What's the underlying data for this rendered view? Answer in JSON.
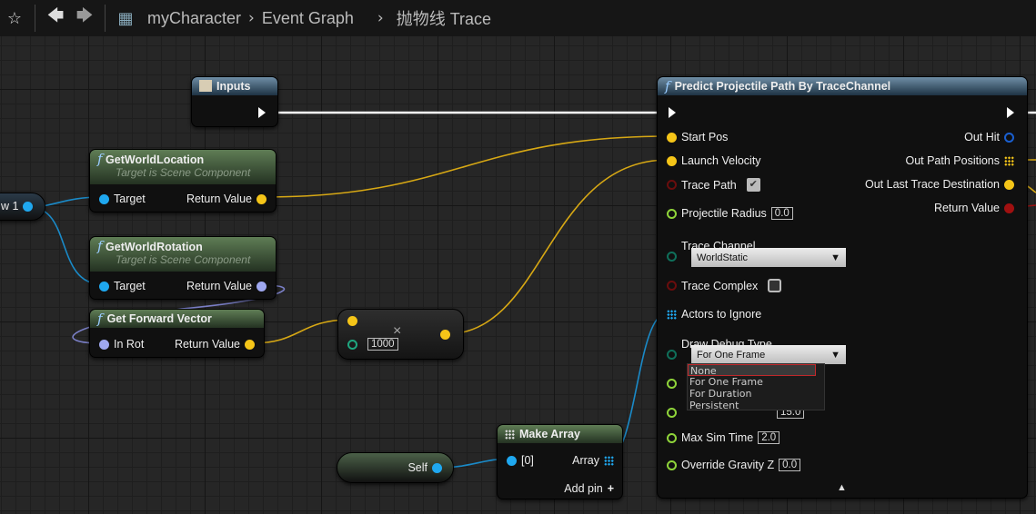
{
  "toolbar": {
    "breadcrumbs": [
      "myCharacter",
      "Event Graph",
      "抛物线 Trace"
    ],
    "icons": [
      "star-icon",
      "back-arrow-icon",
      "forward-arrow-icon",
      "blueprint-icon"
    ]
  },
  "nodes": {
    "var_node": {
      "label": "w 1"
    },
    "inputs": {
      "title": "Inputs"
    },
    "get_world_location": {
      "title": "GetWorldLocation",
      "subtitle": "Target is Scene Component",
      "in": "Target",
      "out": "Return Value"
    },
    "get_world_rotation": {
      "title": "GetWorldRotation",
      "subtitle": "Target is Scene Component",
      "in": "Target",
      "out": "Return Value"
    },
    "get_forward_vector": {
      "title": "Get Forward Vector",
      "in": "In Rot",
      "out": "Return Value"
    },
    "multiply": {
      "symbol": "×",
      "value": "1000"
    },
    "self": {
      "label": "Self"
    },
    "make_array": {
      "title": "Make Array",
      "in": "[0]",
      "out": "Array",
      "add_pin": "Add pin"
    },
    "predict": {
      "title": "Predict Projectile Path By TraceChannel",
      "inputs": {
        "start_pos": "Start Pos",
        "launch_velocity": "Launch Velocity",
        "trace_path": "Trace Path",
        "trace_path_checked": true,
        "projectile_radius": "Projectile Radius",
        "projectile_radius_value": "0.0",
        "trace_channel": "Trace Channel",
        "trace_channel_value": "WorldStatic",
        "trace_complex": "Trace Complex",
        "trace_complex_checked": false,
        "actors_to_ignore": "Actors to Ignore",
        "draw_debug_type": "Draw Debug Type",
        "draw_debug_type_value": "For One Frame",
        "sim_frequency_value": "15.0",
        "max_sim_time": "Max Sim Time",
        "max_sim_time_value": "2.0",
        "override_gravity_z": "Override Gravity Z",
        "override_gravity_z_value": "0.0"
      },
      "outputs": {
        "out_hit": "Out Hit",
        "out_path_positions": "Out Path Positions",
        "out_last_trace_destination": "Out Last Trace Destination",
        "return_value": "Return Value"
      }
    }
  },
  "dropdown": {
    "options": [
      "None",
      "For One Frame",
      "For Duration",
      "Persistent"
    ],
    "highlighted": "None"
  },
  "colors": {
    "vector": "#f5c518",
    "object": "#1fa8f0",
    "rotator": "#9fa8f0",
    "bool": "#8a1010",
    "float": "#8fd43a",
    "byte": "#0f6f5a",
    "exec": "#ffffff"
  }
}
